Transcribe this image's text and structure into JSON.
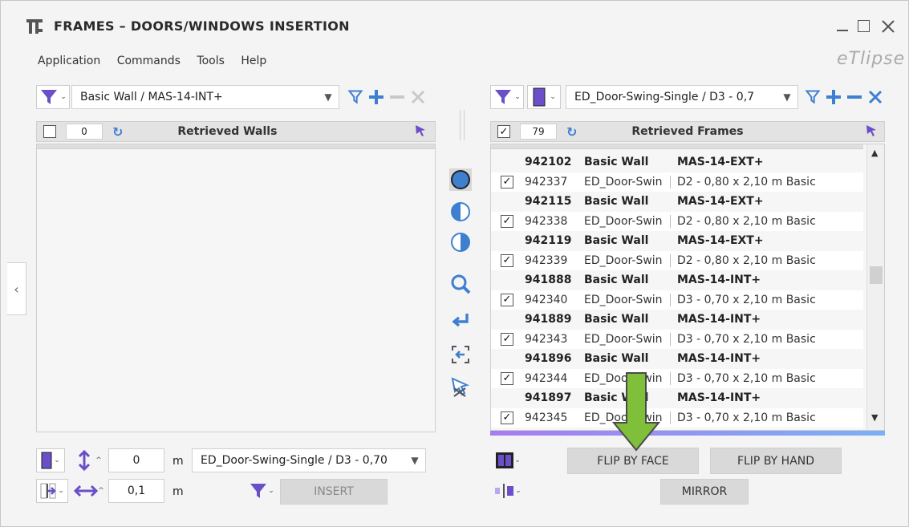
{
  "window": {
    "title": "FRAMES – DOORS/WINDOWS INSERTION",
    "brand": "eTlipse"
  },
  "menu": [
    "Application",
    "Commands",
    "Tools",
    "Help"
  ],
  "left": {
    "filter_value": "Basic Wall / MAS-14-INT+",
    "count": "0",
    "header": "Retrieved Walls"
  },
  "right": {
    "filter_value": "ED_Door-Swing-Single / D3 - 0,7",
    "count": "79",
    "header": "Retrieved Frames",
    "rows": [
      {
        "type": "group",
        "id": "942102",
        "cat": "Basic Wall",
        "name": "MAS-14-EXT+"
      },
      {
        "type": "item",
        "checked": "✓",
        "id": "942337",
        "cat": "ED_Door-Swin",
        "name": "D2 - 0,80 x 2,10 m Basic"
      },
      {
        "type": "group",
        "id": "942115",
        "cat": "Basic Wall",
        "name": "MAS-14-EXT+"
      },
      {
        "type": "item",
        "checked": "✓",
        "id": "942338",
        "cat": "ED_Door-Swin",
        "name": "D2 - 0,80 x 2,10 m Basic"
      },
      {
        "type": "group",
        "id": "942119",
        "cat": "Basic Wall",
        "name": "MAS-14-EXT+"
      },
      {
        "type": "item",
        "checked": "✓",
        "id": "942339",
        "cat": "ED_Door-Swin",
        "name": "D2 - 0,80 x 2,10 m Basic"
      },
      {
        "type": "group",
        "id": "941888",
        "cat": "Basic Wall",
        "name": "MAS-14-INT+"
      },
      {
        "type": "item",
        "checked": "✓",
        "id": "942340",
        "cat": "ED_Door-Swin",
        "name": "D3 - 0,70 x 2,10 m Basic"
      },
      {
        "type": "group",
        "id": "941889",
        "cat": "Basic Wall",
        "name": "MAS-14-INT+"
      },
      {
        "type": "item",
        "checked": "✓",
        "id": "942343",
        "cat": "ED_Door-Swin",
        "name": "D3 - 0,70 x 2,10 m Basic"
      },
      {
        "type": "group",
        "id": "941896",
        "cat": "Basic Wall",
        "name": "MAS-14-INT+"
      },
      {
        "type": "item",
        "checked": "✓",
        "id": "942344",
        "cat": "ED_Door-Swin",
        "name": "D3 - 0,70 x 2,10 m Basic"
      },
      {
        "type": "group",
        "id": "941897",
        "cat": "Basic Wall",
        "name": "MAS-14-INT+"
      },
      {
        "type": "item",
        "checked": "✓",
        "id": "942345",
        "cat": "ED_Door-Swin",
        "name": "D3 - 0,70 x 2,10 m Basic"
      }
    ]
  },
  "bottom": {
    "offset_value": "0",
    "offset_unit": "m",
    "type_value": "ED_Door-Swing-Single / D3 - 0,70",
    "spacing_value": "0,1",
    "spacing_unit": "m",
    "insert_label": "INSERT",
    "flip_face_label": "FLIP BY FACE",
    "flip_hand_label": "FLIP BY HAND",
    "mirror_label": "MIRROR"
  },
  "colors": {
    "accent": "#6a4fc8",
    "icon_blue": "#3f7fd0",
    "arrow_green": "#7fbf3a",
    "scroll_accent": "#9aa8f0"
  }
}
